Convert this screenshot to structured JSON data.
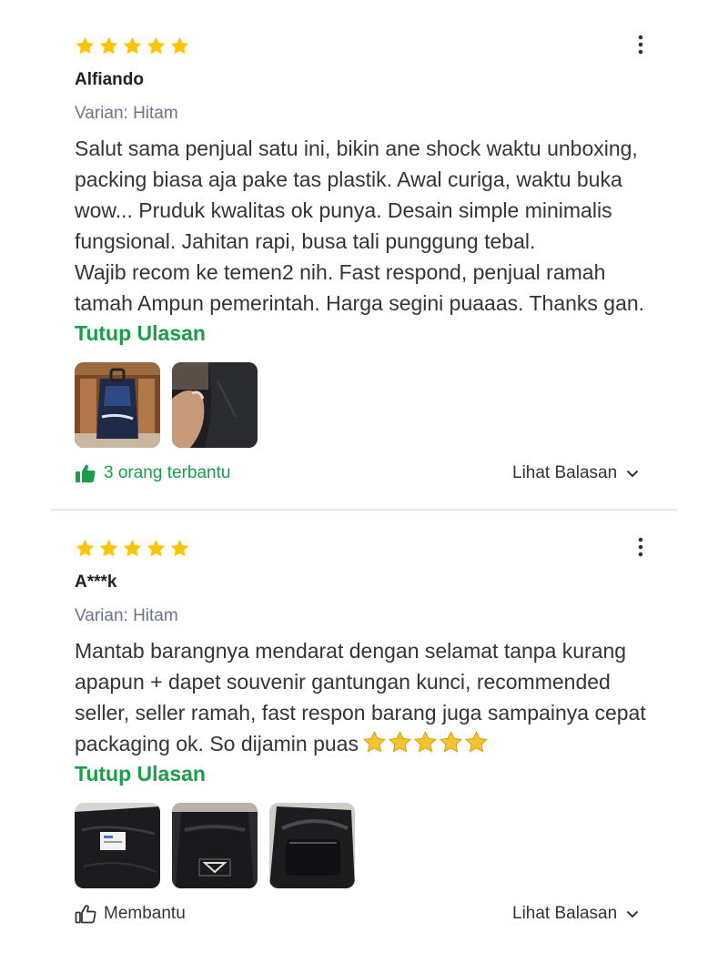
{
  "reviews": [
    {
      "rating": 5,
      "name": "Alfiando",
      "variant": "Varian: Hitam",
      "text": "Salut sama penjual satu ini, bikin ane shock waktu unboxing, packing biasa aja pake tas plastik. Awal curiga, waktu buka wow... Pruduk kwalitas ok punya. Desain simple minimalis fungsional. Jahitan rapi, busa tali punggung tebal.\nWajib recom ke temen2 nih. Fast respond, penjual ramah tamah Ampun pemerintah. Harga segini puaaas. Thanks gan.",
      "toggle_label": "Tutup Ulasan",
      "helpful_label": "3 orang terbantu",
      "replies_label": "Lihat Balasan",
      "accent": "#1a9e4a"
    },
    {
      "rating": 5,
      "name": "A***k",
      "variant": "Varian: Hitam",
      "text": "Mantab barangnya mendarat dengan selamat tanpa kurang apapun + dapet souvenir gantungan kunci, recommended seller, seller ramah, fast respon barang juga sampainya cepat packaging ok. So dijamin puas",
      "text_emoji_stars": 5,
      "toggle_label": "Tutup Ulasan",
      "helpful_label": "Membantu",
      "replies_label": "Lihat Balasan",
      "accent": "#1a9e4a"
    }
  ],
  "colors": {
    "star": "#ffc400",
    "green": "#1a9e4a",
    "text": "#31353b",
    "muted": "#6d7588",
    "divider": "#e5e7e9"
  },
  "icons": {
    "rating_star": "star-icon",
    "more": "more-vertical-icon",
    "helpful_active": "thumbs-up-filled-icon",
    "helpful_inactive": "thumbs-up-outline-icon",
    "replies": "chevron-down-icon"
  }
}
